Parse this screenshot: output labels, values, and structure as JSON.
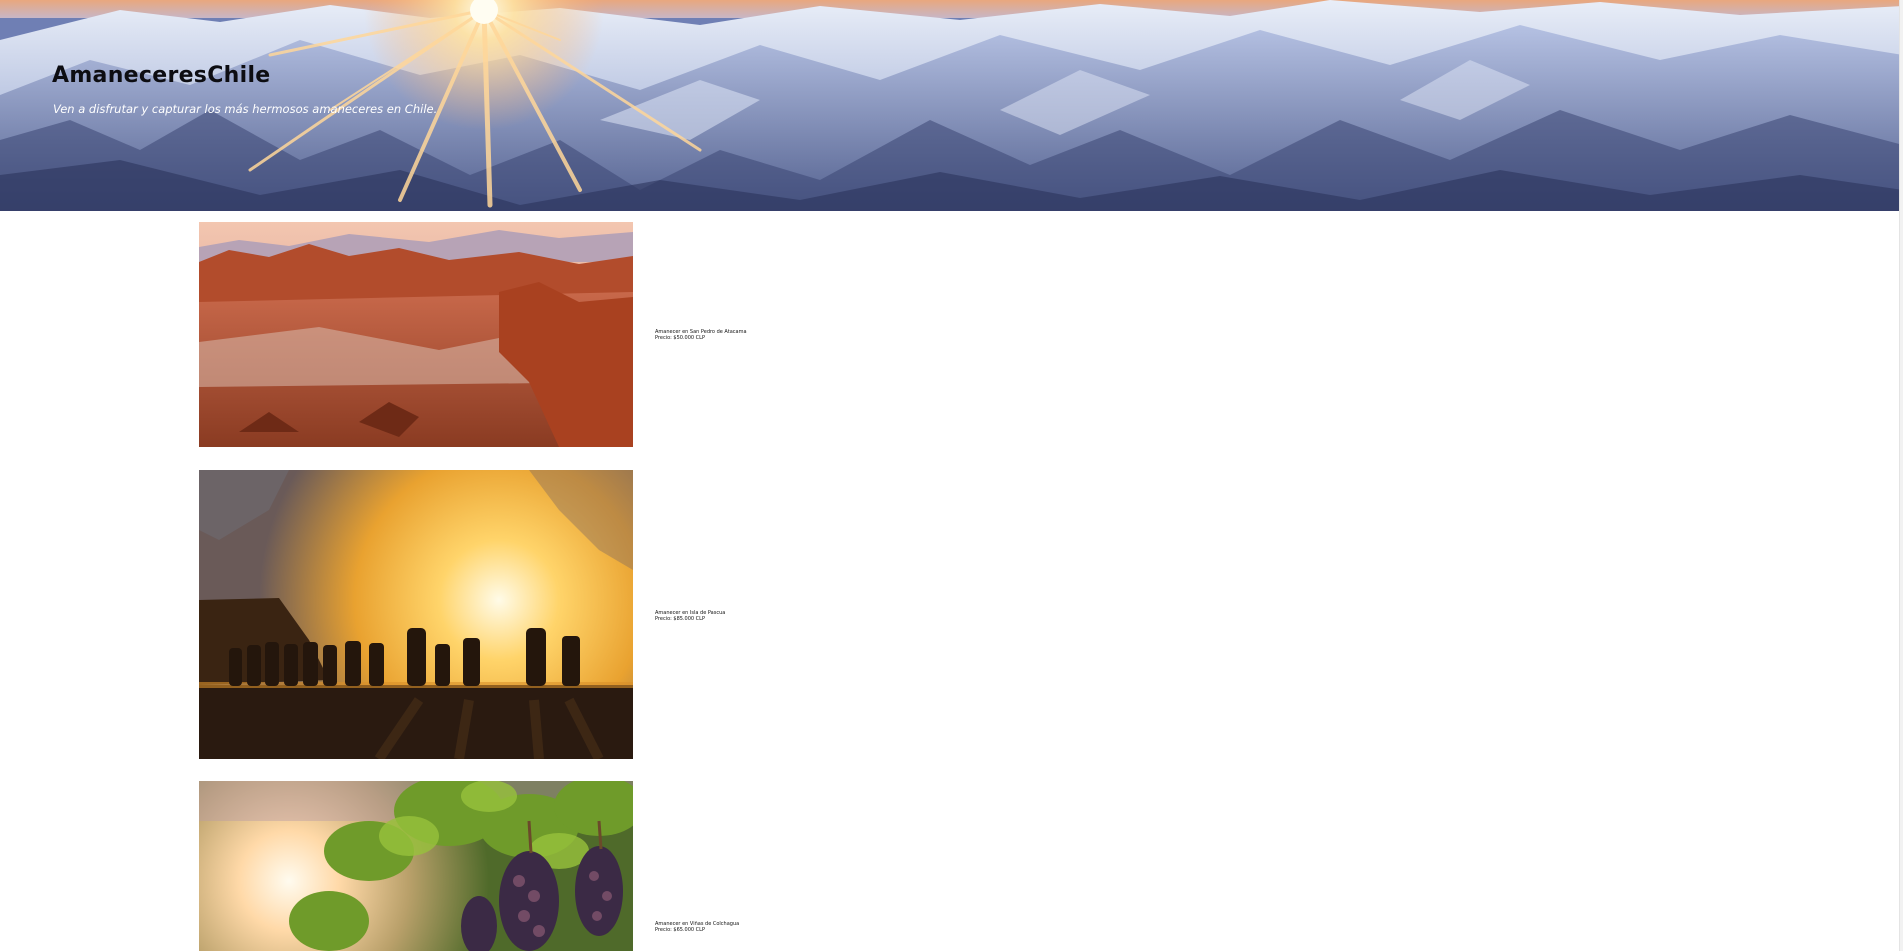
{
  "header": {
    "title": "AmaneceresChile",
    "tagline": "Ven a disfrutar y capturar los más hermosos amaneceres en Chile."
  },
  "products": [
    {
      "name": "Amanecer en San Pedro de Atacama",
      "price": "Precio: $50.000 CLP",
      "image": "atacama-desert-sunrise"
    },
    {
      "name": "Amanecer en Isla de Pascua",
      "price": "Precio: $85.000 CLP",
      "image": "easter-island-moai-sunrise"
    },
    {
      "name": "Amanecer en Viñas de Colchagua",
      "price": "Precio: $65.000 CLP",
      "image": "colchagua-vineyard-sunrise"
    }
  ],
  "colors": {
    "background": "#ffffff",
    "title": "#0d0d12",
    "tagline": "#ffffff"
  }
}
